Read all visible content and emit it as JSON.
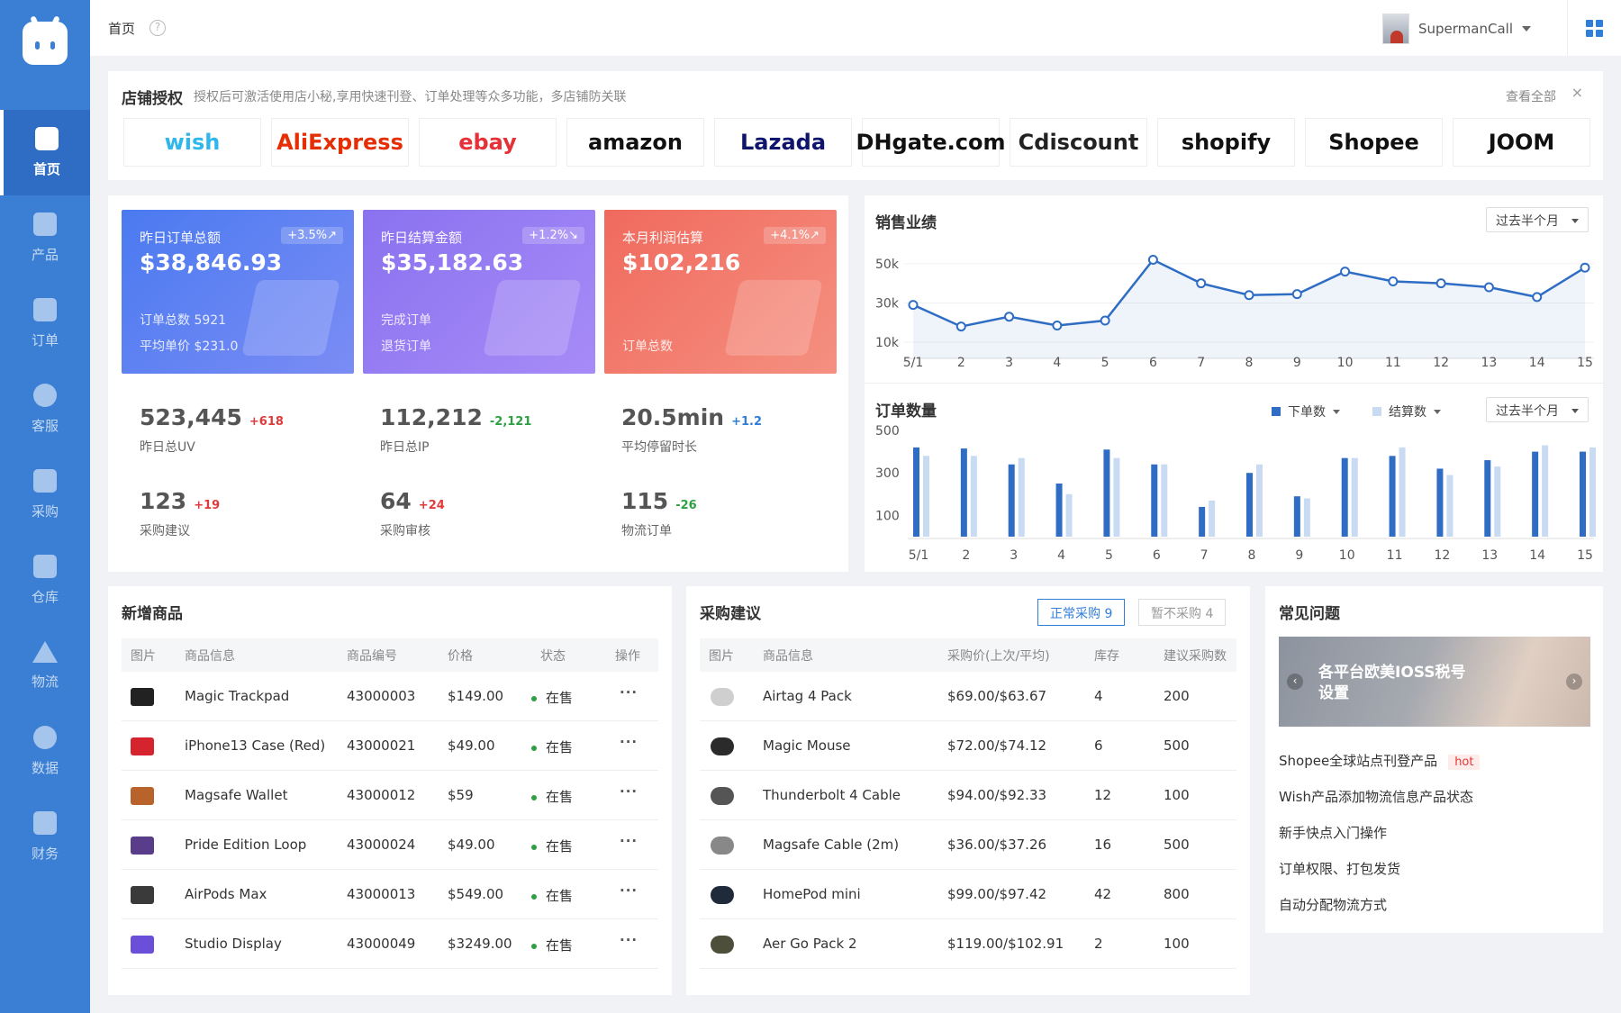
{
  "nav": [
    {
      "label": "首页",
      "icon": "home-icon",
      "active": true
    },
    {
      "label": "产品",
      "icon": "cube-icon"
    },
    {
      "label": "订单",
      "icon": "document-icon"
    },
    {
      "label": "客服",
      "icon": "chat-icon"
    },
    {
      "label": "采购",
      "icon": "clipboard-check-icon"
    },
    {
      "label": "仓库",
      "icon": "warehouse-icon"
    },
    {
      "label": "物流",
      "icon": "send-icon"
    },
    {
      "label": "数据",
      "icon": "chart-icon"
    },
    {
      "label": "财务",
      "icon": "wallet-icon"
    }
  ],
  "header": {
    "breadcrumb": "首页",
    "help": "?",
    "username": "SupermanCall"
  },
  "store": {
    "title": "店铺授权",
    "desc": "授权后可激活使用店小秘,享用快速刊登、订单处理等众多功能，多店铺防关联",
    "view_all": "查看全部",
    "close": "×",
    "platforms": [
      {
        "name": "wish",
        "color": "#2fb7ec"
      },
      {
        "name": "AliExpress",
        "color": "#e62e04"
      },
      {
        "name": "ebay",
        "color": "#e53238"
      },
      {
        "name": "amazon",
        "color": "#111111"
      },
      {
        "name": "Lazada",
        "color": "#0f146d"
      },
      {
        "name": "DHgate.com",
        "color": "#111111"
      },
      {
        "name": "Cdiscount",
        "color": "#222222"
      },
      {
        "name": "shopify",
        "color": "#111111"
      },
      {
        "name": "Shopee",
        "color": "#111111"
      },
      {
        "name": "JOOM",
        "color": "#111111"
      }
    ]
  },
  "stat_cards": [
    {
      "label": "昨日订单总额",
      "badge": "+3.5%↗",
      "value": "$38,846.93",
      "sub1": "订单总数 5921",
      "sub2": "平均单价 $231.0"
    },
    {
      "label": "昨日结算金额",
      "badge": "+1.2%↘",
      "value": "$35,182.63",
      "sub1": "完成订单",
      "sub2": "退货订单"
    },
    {
      "label": "本月利润估算",
      "badge": "+4.1%↗",
      "value": "$102,216",
      "sub1": "",
      "sub2": "订单总数"
    }
  ],
  "kpis": [
    {
      "value": "523,445",
      "delta": "+618",
      "label": "昨日总UV"
    },
    {
      "value": "112,212",
      "delta": "-2,121",
      "label": "昨日总IP"
    },
    {
      "value": "20.5min",
      "delta": "+1.2",
      "label": "平均停留时长"
    },
    {
      "value": "123",
      "delta": "+19",
      "label": "采购建议"
    },
    {
      "value": "64",
      "delta": "+24",
      "label": "采购审核"
    },
    {
      "value": "115",
      "delta": "-26",
      "label": "物流订单"
    }
  ],
  "sales_panel": {
    "title": "销售业绩",
    "range": "过去半个月"
  },
  "orders_panel": {
    "title": "订单数量",
    "range": "过去半个月",
    "legend1": "下单数",
    "legend2": "结算数"
  },
  "chart_data": [
    {
      "type": "area",
      "title": "销售业绩",
      "categories": [
        "5/1",
        "2",
        "3",
        "4",
        "5",
        "6",
        "7",
        "8",
        "9",
        "10",
        "11",
        "12",
        "13",
        "14",
        "15"
      ],
      "values": [
        29000,
        18000,
        23000,
        18500,
        21000,
        52000,
        40000,
        34000,
        34500,
        46000,
        41000,
        40000,
        38000,
        33000,
        48000
      ],
      "yticks": [
        "50k",
        "30k",
        "10k"
      ],
      "ylim": [
        10000,
        55000
      ],
      "color": "#2f6dc4"
    },
    {
      "type": "bar",
      "title": "订单数量",
      "categories": [
        "5/1",
        "2",
        "3",
        "4",
        "5",
        "6",
        "7",
        "8",
        "9",
        "10",
        "11",
        "12",
        "13",
        "14",
        "15"
      ],
      "yticks": [
        "500",
        "300",
        "100"
      ],
      "ylim": [
        0,
        500
      ],
      "series": [
        {
          "name": "下单数",
          "color": "#2f6dc4",
          "values": [
            420,
            415,
            340,
            250,
            410,
            340,
            140,
            300,
            190,
            370,
            380,
            320,
            360,
            400,
            400
          ]
        },
        {
          "name": "结算数",
          "color": "#c9daf3",
          "values": [
            380,
            380,
            370,
            200,
            370,
            340,
            170,
            340,
            180,
            370,
            420,
            290,
            330,
            430,
            420
          ]
        }
      ]
    }
  ],
  "new_products": {
    "title": "新增商品",
    "columns": [
      "图片",
      "商品信息",
      "商品编号",
      "价格",
      "状态",
      "操作"
    ],
    "rows": [
      {
        "name": "Magic Trackpad",
        "sku": "43000003",
        "price": "$149.00",
        "status": "在售",
        "op": "···",
        "thumb": "#222222"
      },
      {
        "name": "iPhone13 Case (Red)",
        "sku": "43000021",
        "price": "$49.00",
        "status": "在售",
        "op": "···",
        "thumb": "#d6242e"
      },
      {
        "name": "Magsafe Wallet",
        "sku": "43000012",
        "price": "$59",
        "status": "在售",
        "op": "···",
        "thumb": "#b8622c"
      },
      {
        "name": "Pride Edition Loop",
        "sku": "43000024",
        "price": "$49.00",
        "status": "在售",
        "op": "···",
        "thumb": "#5a3d8a"
      },
      {
        "name": "AirPods Max",
        "sku": "43000013",
        "price": "$549.00",
        "status": "在售",
        "op": "···",
        "thumb": "#3a3a3a"
      },
      {
        "name": "Studio Display",
        "sku": "43000049",
        "price": "$3249.00",
        "status": "在售",
        "op": "···",
        "thumb": "#6b4fd8"
      }
    ]
  },
  "purchase": {
    "title": "采购建议",
    "tab_on": "正常采购 9",
    "tab_off": "暂不采购 4",
    "columns": [
      "图片",
      "商品信息",
      "采购价(上次/平均)",
      "库存",
      "建议采购数"
    ],
    "rows": [
      {
        "name": "Airtag 4 Pack",
        "price": "$69.00/$63.67",
        "stock": "4",
        "suggest": "200",
        "thumb": "#cfcfcf"
      },
      {
        "name": "Magic Mouse",
        "price": "$72.00/$74.12",
        "stock": "6",
        "suggest": "500",
        "thumb": "#2b2b2b"
      },
      {
        "name": "Thunderbolt 4 Cable",
        "price": "$94.00/$92.33",
        "stock": "12",
        "suggest": "100",
        "thumb": "#555555"
      },
      {
        "name": "Magsafe Cable (2m)",
        "price": "$36.00/$37.26",
        "stock": "16",
        "suggest": "500",
        "thumb": "#888888"
      },
      {
        "name": "HomePod mini",
        "price": "$99.00/$97.42",
        "stock": "42",
        "suggest": "800",
        "thumb": "#1f2a3a"
      },
      {
        "name": "Aer Go Pack 2",
        "price": "$119.00/$102.91",
        "stock": "2",
        "suggest": "100",
        "thumb": "#4d4f3a"
      }
    ]
  },
  "faq": {
    "title": "常见问题",
    "banner": "各平台欧美IOSS税号设置",
    "items": [
      "Shopee全球站点刊登产品",
      "Wish产品添加物流信息产品状态",
      "新手快点入门操作",
      "订单权限、打包发货",
      "自动分配物流方式"
    ],
    "hot": "hot"
  }
}
